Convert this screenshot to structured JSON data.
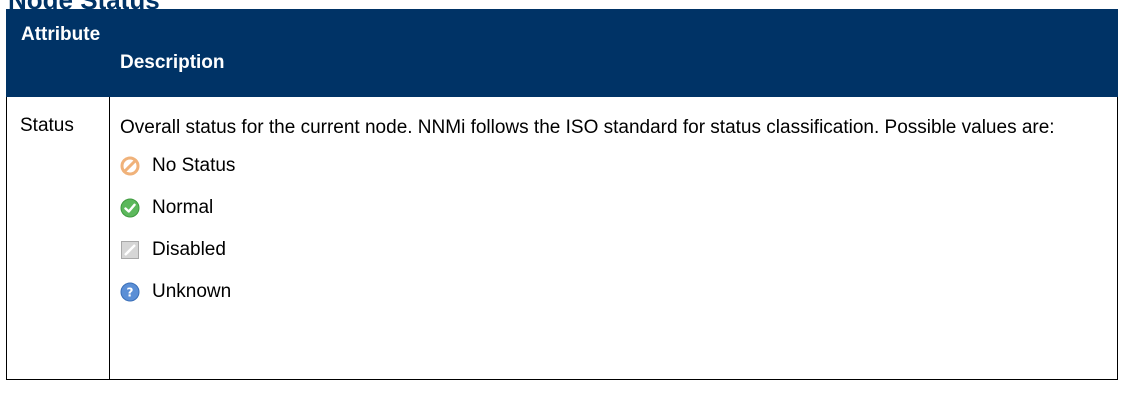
{
  "section_heading": "Node Status",
  "table": {
    "headers": {
      "attribute": "Attribute",
      "description": "Description"
    },
    "rows": [
      {
        "attribute": "Status",
        "description": "Overall status for the current node. NNMi follows the ISO standard for status classification. Possible values are:",
        "status_values": [
          {
            "label": "No Status",
            "icon": "no-status-icon",
            "color": "#f0b27a"
          },
          {
            "label": "Normal",
            "icon": "normal-status-icon",
            "color": "#5cb85c"
          },
          {
            "label": "Disabled",
            "icon": "disabled-status-icon",
            "color": "#c8c8c8"
          },
          {
            "label": "Unknown",
            "icon": "unknown-status-icon",
            "color": "#5b8fd6"
          }
        ]
      }
    ]
  },
  "colors": {
    "header_bg": "#003366",
    "header_text": "#ffffff",
    "border": "#000000"
  }
}
